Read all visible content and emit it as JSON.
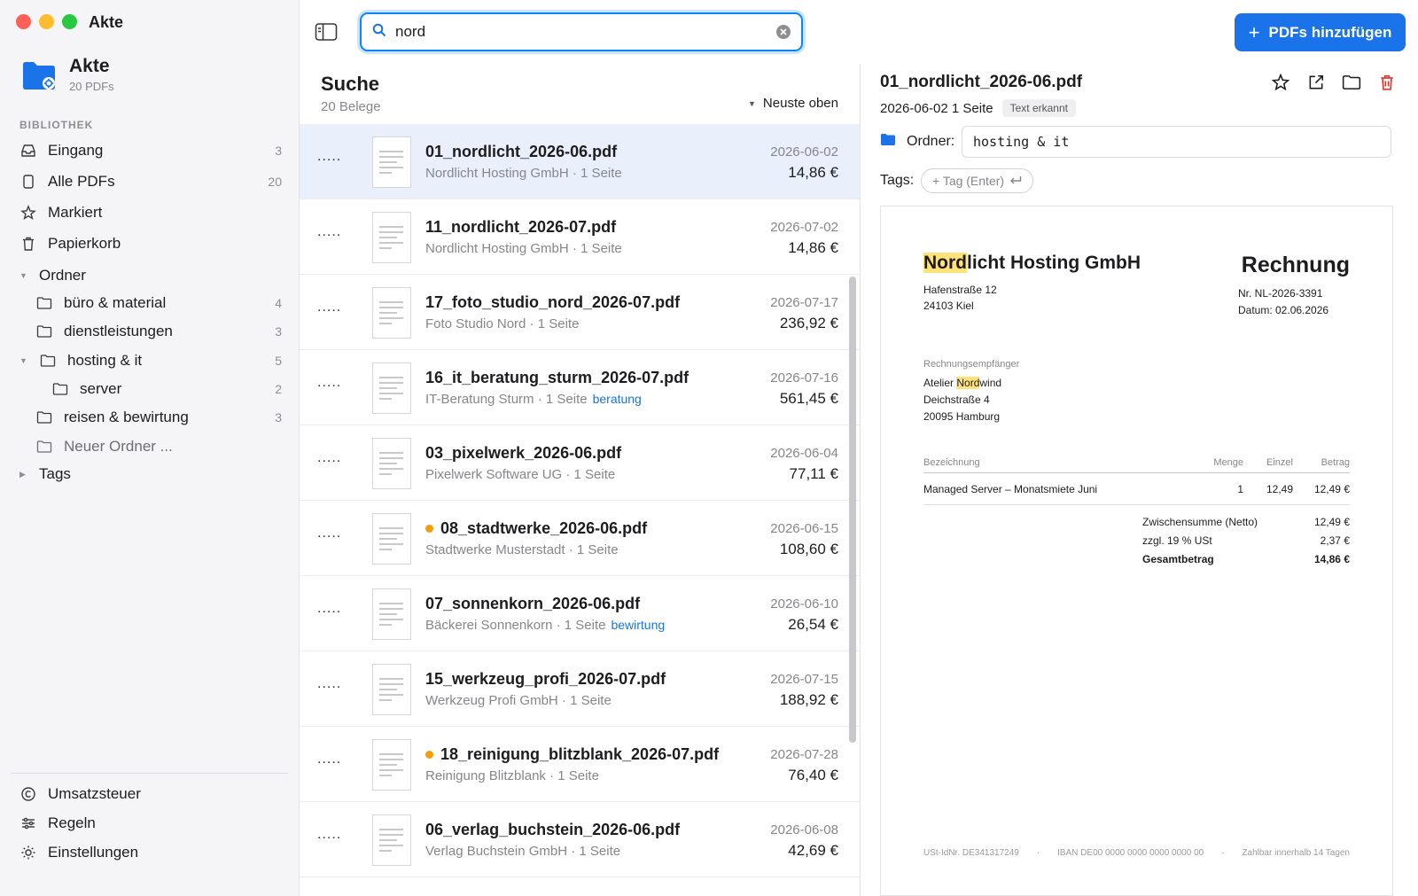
{
  "window": {
    "title": "Akte"
  },
  "brand": {
    "name": "Akte",
    "count_label": "20 PDFs"
  },
  "sidebar": {
    "section_label": "BIBLIOTHEK",
    "library": [
      {
        "label": "Eingang",
        "count": "3",
        "icon": "inbox-icon"
      },
      {
        "label": "Alle PDFs",
        "count": "20",
        "icon": "document-icon"
      },
      {
        "label": "Markiert",
        "count": "",
        "icon": "star-icon"
      },
      {
        "label": "Papierkorb",
        "count": "",
        "icon": "trash-icon"
      }
    ],
    "folders_label": "Ordner",
    "folders": [
      {
        "label": "büro & material",
        "count": "4"
      },
      {
        "label": "dienstleistungen",
        "count": "3"
      },
      {
        "label": "hosting & it",
        "count": "5"
      },
      {
        "label": "server",
        "count": "2"
      },
      {
        "label": "reisen & bewirtung",
        "count": "3"
      },
      {
        "label": "Neuer Ordner ...",
        "count": ""
      }
    ],
    "tags_label": "Tags",
    "bottom": [
      {
        "label": "Umsatzsteuer",
        "icon": "copyright-icon"
      },
      {
        "label": "Regeln",
        "icon": "sliders-icon"
      },
      {
        "label": "Einstellungen",
        "icon": "sun-icon"
      }
    ]
  },
  "toolbar": {
    "search_value": "nord",
    "add_button": "PDFs hinzufügen",
    "accent": "#1a73e8"
  },
  "list": {
    "title": "Suche",
    "subtitle": "20 Belege",
    "sort_label": "Neuste oben",
    "handle": ".....",
    "rows": [
      {
        "name": "01_nordlicht_2026-06.pdf",
        "meta": "Nordlicht Hosting GmbH · 1 Seite",
        "tag": "",
        "date": "2026-06-02",
        "amount": "14,86 €",
        "dot": false
      },
      {
        "name": "11_nordlicht_2026-07.pdf",
        "meta": "Nordlicht Hosting GmbH · 1 Seite",
        "tag": "",
        "date": "2026-07-02",
        "amount": "14,86 €",
        "dot": false
      },
      {
        "name": "17_foto_studio_nord_2026-07.pdf",
        "meta": "Foto Studio Nord · 1 Seite",
        "tag": "",
        "date": "2026-07-17",
        "amount": "236,92 €",
        "dot": false
      },
      {
        "name": "16_it_beratung_sturm_2026-07.pdf",
        "meta": "IT-Beratung Sturm · 1 Seite",
        "tag": "beratung",
        "date": "2026-07-16",
        "amount": "561,45 €",
        "dot": false
      },
      {
        "name": "03_pixelwerk_2026-06.pdf",
        "meta": "Pixelwerk Software UG · 1 Seite",
        "tag": "",
        "date": "2026-06-04",
        "amount": "77,11 €",
        "dot": false
      },
      {
        "name": "08_stadtwerke_2026-06.pdf",
        "meta": "Stadtwerke Musterstadt · 1 Seite",
        "tag": "",
        "date": "2026-06-15",
        "amount": "108,60 €",
        "dot": true
      },
      {
        "name": "07_sonnenkorn_2026-06.pdf",
        "meta": "Bäckerei Sonnenkorn · 1 Seite",
        "tag": "bewirtung",
        "date": "2026-06-10",
        "amount": "26,54 €",
        "dot": false
      },
      {
        "name": "15_werkzeug_profi_2026-07.pdf",
        "meta": "Werkzeug Profi GmbH · 1 Seite",
        "tag": "",
        "date": "2026-07-15",
        "amount": "188,92 €",
        "dot": false
      },
      {
        "name": "18_reinigung_blitzblank_2026-07.pdf",
        "meta": "Reinigung Blitzblank · 1 Seite",
        "tag": "",
        "date": "2026-07-28",
        "amount": "76,40 €",
        "dot": true
      },
      {
        "name": "06_verlag_buchstein_2026-06.pdf",
        "meta": "Verlag Buchstein GmbH · 1 Seite",
        "tag": "",
        "date": "2026-06-08",
        "amount": "42,69 €",
        "dot": false
      }
    ]
  },
  "detail": {
    "title": "01_nordlicht_2026-06.pdf",
    "date": "2026-06-02",
    "pages": "1 Seite",
    "badge": "Text erkannt",
    "folder_label": "Ordner:",
    "folder_value": "hosting & it",
    "tags_label": "Tags:",
    "tag_placeholder": "+ Tag (Enter)",
    "invoice": {
      "company_hl": "Nord",
      "company_rest": "licht Hosting GmbH",
      "street": "Hafenstraße 12",
      "city": "24103 Kiel",
      "doc_title": "Rechnung",
      "number": "Nr. NL-2026-3391",
      "doc_date": "Datum: 02.06.2026",
      "recipient_label": "Rechnungsempfänger",
      "recipient_pre": "Atelier ",
      "recipient_hl": "Nord",
      "recipient_post": "wind",
      "recipient_street": "Deichstraße 4",
      "recipient_city": "20095 Hamburg",
      "cols": {
        "desc": "Bezeichnung",
        "qty": "Menge",
        "unit": "Einzel",
        "total": "Betrag"
      },
      "item": {
        "desc": "Managed Server – Monatsmiete Juni",
        "qty": "1",
        "unit": "12,49",
        "total": "12,49 €"
      },
      "subtotal_label": "Zwischensumme (Netto)",
      "subtotal": "12,49 €",
      "tax_label": "zzgl. 19 % USt",
      "tax": "2,37 €",
      "grand_label": "Gesamtbetrag",
      "grand": "14,86 €",
      "footer_vat": "USt-IdNr. DE341317249",
      "footer_iban": "IBAN DE00 0000 0000 0000 0000 00",
      "footer_terms": "Zahlbar innerhalb 14 Tagen"
    }
  }
}
